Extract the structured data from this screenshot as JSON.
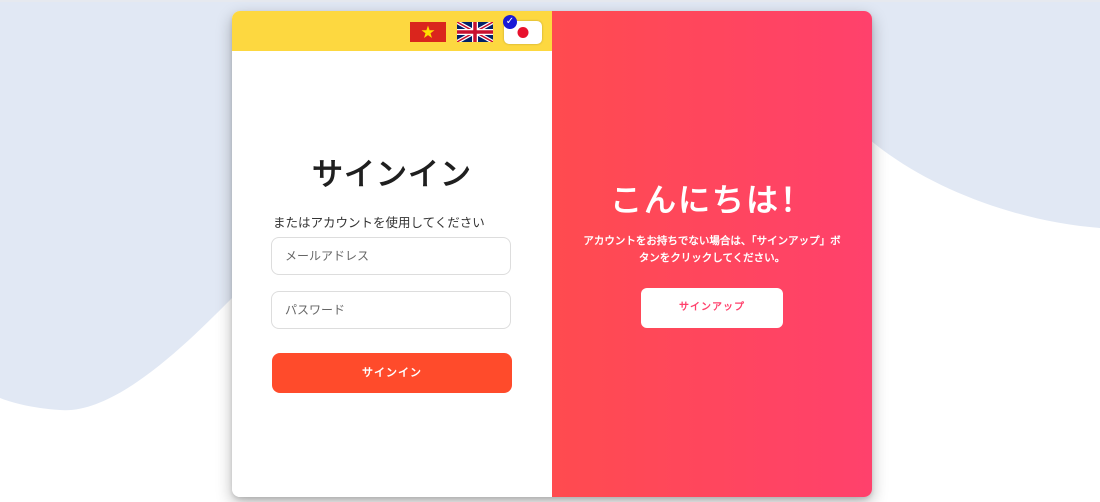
{
  "languages": {
    "items": [
      {
        "code": "vi",
        "icon": "vietnam-flag-icon",
        "selected": false
      },
      {
        "code": "en",
        "icon": "uk-flag-icon",
        "selected": false
      },
      {
        "code": "ja",
        "icon": "japan-flag-icon",
        "selected": true
      }
    ],
    "bar_color": "#fdd840",
    "selected_check": "✓"
  },
  "signin": {
    "title": "サインイン",
    "subtitle": "またはアカウントを使用してください",
    "email_placeholder": "メールアドレス",
    "email_value": "",
    "password_placeholder": "パスワード",
    "password_value": "",
    "button_label": "サインイン",
    "button_color": "#ff4b2b"
  },
  "welcome": {
    "title": "こんにちは！",
    "text": "アカウントをお持ちでない場合は、「サインアップ」ボタンをクリックしてください。",
    "button_label": "サインアップ",
    "gradient_start": "#ff4b4f",
    "gradient_end": "#ff416c"
  },
  "colors": {
    "background_wave": "#e1e8f4",
    "page_background": "#ffffff"
  }
}
